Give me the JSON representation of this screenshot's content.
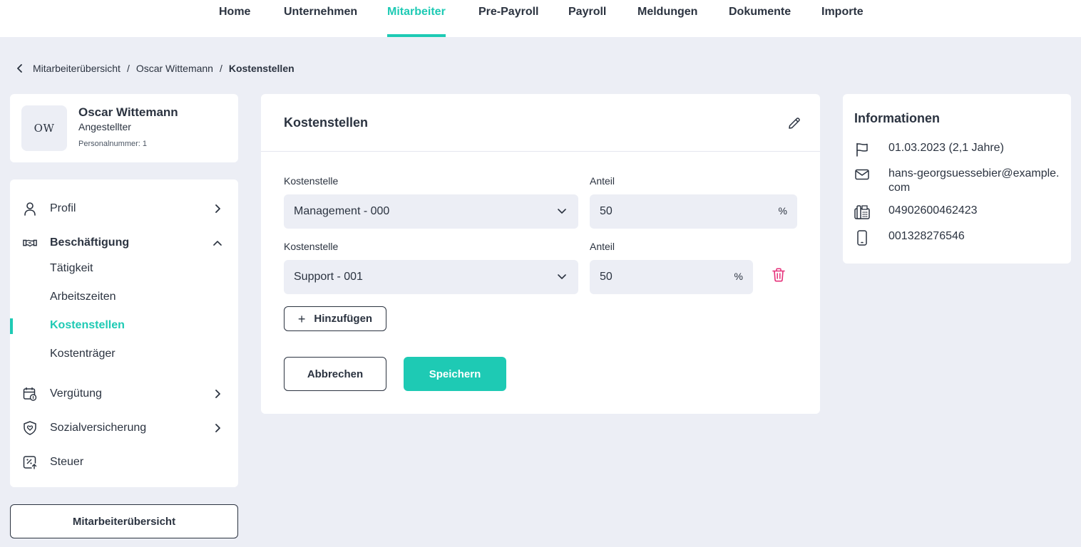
{
  "nav": {
    "items": [
      "Home",
      "Unternehmen",
      "Mitarbeiter",
      "Pre-Payroll",
      "Payroll",
      "Meldungen",
      "Dokumente",
      "Importe"
    ],
    "active": "Mitarbeiter"
  },
  "breadcrumb": {
    "items": [
      "Mitarbeiterübersicht",
      "Oscar Wittemann"
    ],
    "current": "Kostenstellen",
    "separator": "/"
  },
  "profile": {
    "initials": "OW",
    "name": "Oscar Wittemann",
    "role": "Angestellter",
    "personnel_number": "Personalnummer: 1"
  },
  "menu": {
    "profile": "Profil",
    "employment": "Beschäftigung",
    "employment_sub": [
      "Tätigkeit",
      "Arbeitszeiten",
      "Kostenstellen",
      "Kostenträger"
    ],
    "employment_active": "Kostenstellen",
    "compensation": "Vergütung",
    "social_insurance": "Sozialversicherung",
    "tax": "Steuer"
  },
  "overview_button": "Mitarbeiterübersicht",
  "form": {
    "title": "Kostenstellen",
    "rows": [
      {
        "cost_center_label": "Kostenstelle",
        "cost_center_value": "Management - 000",
        "share_label": "Anteil",
        "share_value": "50",
        "unit": "%"
      },
      {
        "cost_center_label": "Kostenstelle",
        "cost_center_value": "Support - 001",
        "share_label": "Anteil",
        "share_value": "50",
        "unit": "%"
      }
    ],
    "add_label": "Hinzufügen",
    "cancel_label": "Abbrechen",
    "save_label": "Speichern"
  },
  "info": {
    "title": "Informationen",
    "start_date": "01.03.2023 (2,1 Jahre)",
    "email": "hans-georgsuessebier@example.com",
    "phone": "04902600462423",
    "mobile": "001328276546"
  },
  "icons": {
    "back": "chevron-left-icon",
    "profile": "user-icon",
    "employment": "handshake-icon",
    "compensation": "calendar-money-icon",
    "social_insurance": "shield-heart-icon",
    "tax": "percent-arrow-icon",
    "edit": "pencil-icon",
    "delete": "trash-icon",
    "start": "flag-icon",
    "email": "mail-icon",
    "phone": "phone-icon",
    "mobile": "smartphone-icon"
  },
  "colors": {
    "accent": "#1ecab4",
    "text": "#2b3340",
    "background": "#eceef5",
    "danger": "#e6307a"
  }
}
